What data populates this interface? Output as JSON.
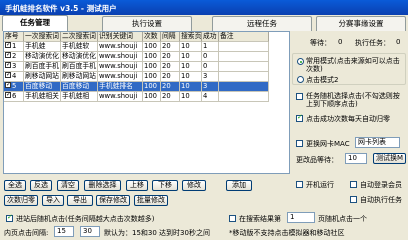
{
  "window": {
    "title": "手机蛙排名软件 v3.5 - 测试用户"
  },
  "tabs": [
    "任务管理",
    "执行设置",
    "远程任务",
    "分赛事缘设置"
  ],
  "grid": {
    "headers": [
      "序号",
      "一次搜索词",
      "二次搜索词",
      "识别关键词",
      "次数",
      "间隔",
      "搜索页",
      "成功",
      "备注"
    ],
    "rows": [
      {
        "seq": "1",
        "checked": true,
        "kw1": "手机蛙",
        "kw2": "手机蛙软",
        "id": "www.shouji",
        "count": "100",
        "interval": "20",
        "page": "10",
        "success": "1",
        "note": "",
        "selected": false
      },
      {
        "seq": "2",
        "checked": true,
        "kw1": "移动演优化",
        "kw2": "移动演优化",
        "id": "www.shouji",
        "count": "100",
        "interval": "20",
        "page": "10",
        "success": "0",
        "note": "",
        "selected": false
      },
      {
        "seq": "3",
        "checked": true,
        "kw1": "刷百度手机",
        "kw2": "刷百度手机",
        "id": "www.shouji",
        "count": "100",
        "interval": "20",
        "page": "10",
        "success": "0",
        "note": "",
        "selected": false
      },
      {
        "seq": "4",
        "checked": true,
        "kw1": "刷移动网站",
        "kw2": "刷移动网站",
        "id": "www.shouji",
        "count": "100",
        "interval": "20",
        "page": "10",
        "success": "3",
        "note": "",
        "selected": false
      },
      {
        "seq": "5",
        "checked": true,
        "kw1": "百度移动",
        "kw2": "百度移动",
        "id": "手机蛙排名",
        "count": "100",
        "interval": "20",
        "page": "10",
        "success": "3",
        "note": "",
        "selected": true
      },
      {
        "seq": "6",
        "checked": true,
        "kw1": "手机蛙相关",
        "kw2": "手机蛙相",
        "id": "www.shouji",
        "count": "100",
        "interval": "20",
        "page": "10",
        "success": "4",
        "note": "",
        "selected": false
      }
    ]
  },
  "grid_buttons": [
    "全选",
    "反选",
    "清空",
    "删除选择",
    "上移",
    "下移",
    "修改",
    "添加"
  ],
  "bottom_buttons": [
    "次数归零",
    "导入",
    "导出",
    "保存修改",
    "批量修改"
  ],
  "options": {
    "enter_link_label": "进站后随机点击(任务间隔越大点击次数越多)",
    "enter_link_checked": true,
    "inner_page_label": "内页点击间隔:",
    "inner_from": "15",
    "inner_to": "30",
    "inner_hint": "默认为：15和30 达到时30秒之间",
    "search_page_label": "在搜索结果第",
    "search_page_value": "1",
    "search_page_suffix": "页随机点击一个",
    "random_click_hint": "*移动版不支持点击模拟器和移动社区",
    "mobile_note": ""
  },
  "right_panel": {
    "wait_label": "等待：",
    "wait_value": "0",
    "exec_label": "执行任务：",
    "exec_value": "0",
    "mode1": "常用模式(点击来源如可以点击次数)",
    "mode1_checked": true,
    "mode2": "点击模式2",
    "mode2_checked": false,
    "auto_order": "任务随机选择点击(不勾选则按上到下顺序点击)",
    "auto_order_checked": false,
    "auto_reset": "点击成功次数每天自动归零",
    "auto_reset_checked": true,
    "mac_label": "更换网卡MAC",
    "mac_button": "网卡列表",
    "ip_label": "更改品等待：",
    "ip_value": "10",
    "ip_suffix": "测试换M",
    "autorun_label": "开机运行",
    "autologin_label": "自动登录会员",
    "autoexec_label": "自动执行任务"
  }
}
